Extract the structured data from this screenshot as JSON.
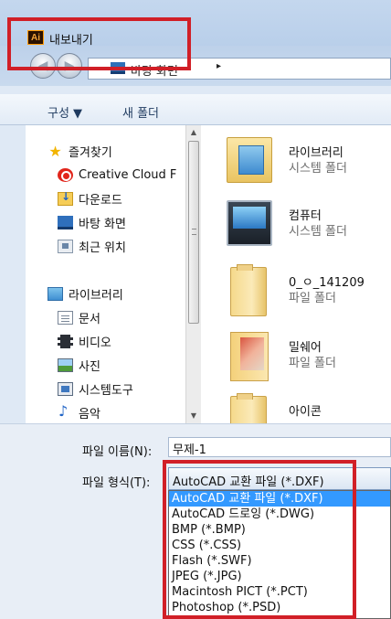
{
  "window": {
    "app_icon_text": "Ai",
    "title": "내보내기"
  },
  "address_bar": {
    "location": "바탕 화면",
    "arrow": "▸"
  },
  "toolbar": {
    "organize_label": "구성 ▼",
    "new_folder_label": "새 폴더"
  },
  "nav": {
    "items": [
      {
        "label": "즐겨찾기",
        "icon": "star-icon"
      },
      {
        "label": "Creative Cloud F",
        "icon": "creative-cloud-icon"
      },
      {
        "label": "다운로드",
        "icon": "downloads-icon"
      },
      {
        "label": "바탕 화면",
        "icon": "desktop-icon"
      },
      {
        "label": "최근 위치",
        "icon": "recent-places-icon"
      },
      {
        "label": "라이브러리",
        "icon": "libraries-icon"
      },
      {
        "label": "문서",
        "icon": "documents-icon"
      },
      {
        "label": "비디오",
        "icon": "videos-icon"
      },
      {
        "label": "사진",
        "icon": "pictures-icon"
      },
      {
        "label": "시스템도구",
        "icon": "system-tools-icon"
      },
      {
        "label": "음악",
        "icon": "music-icon"
      }
    ]
  },
  "content": {
    "items": [
      {
        "name": "라이브러리",
        "type": "시스템 폴더",
        "icon": "library-folder-icon"
      },
      {
        "name": "컴퓨터",
        "type": "시스템 폴더",
        "icon": "computer-icon"
      },
      {
        "name": "0_ㅇ_141209",
        "type": "파일 폴더",
        "icon": "folder-icon"
      },
      {
        "name": "밀쉐어",
        "type": "파일 폴더",
        "icon": "picture-folder-icon"
      },
      {
        "name": "아이콘",
        "type": "",
        "icon": "folder-icon"
      }
    ]
  },
  "form": {
    "filename_label": "파일 이름(N):",
    "filename_value": "무제-1",
    "filetype_label": "파일 형식(T):",
    "filetype_value": "AutoCAD 교환 파일 (*.DXF)"
  },
  "filetype_options": [
    "AutoCAD 교환 파일 (*.DXF)",
    "AutoCAD 드로잉 (*.DWG)",
    "BMP (*.BMP)",
    "CSS (*.CSS)",
    "Flash (*.SWF)",
    "JPEG (*.JPG)",
    "Macintosh PICT (*.PCT)",
    "Photoshop (*.PSD)"
  ],
  "colors": {
    "highlight_box": "#d11f27",
    "selection": "#3399ff"
  }
}
